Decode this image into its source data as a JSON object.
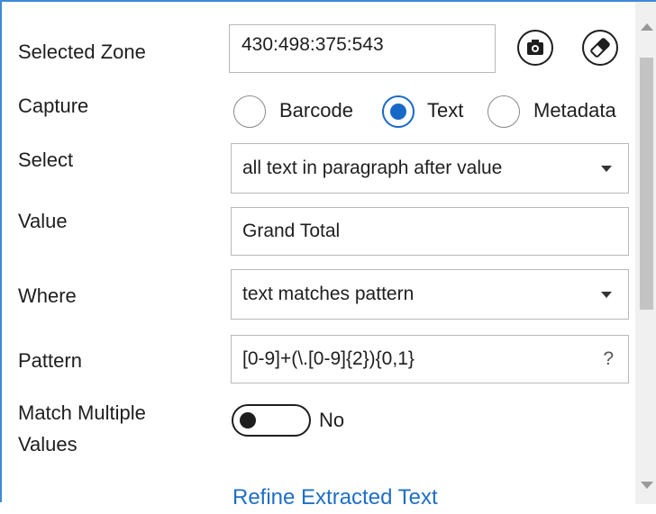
{
  "fields": {
    "selected_zone": {
      "label": "Selected Zone",
      "value": "430:498:375:543"
    },
    "capture": {
      "label": "Capture",
      "options": [
        "Barcode",
        "Text",
        "Metadata"
      ],
      "selected": "Text"
    },
    "select": {
      "label": "Select",
      "value": "all text in paragraph after value"
    },
    "value": {
      "label": "Value",
      "value": "Grand Total"
    },
    "where": {
      "label": "Where",
      "value": "text matches pattern"
    },
    "pattern": {
      "label": "Pattern",
      "value": "[0-9]+(\\.[0-9]{2}){0,1}",
      "help": "?"
    },
    "match_multiple": {
      "label_line1": "Match Multiple",
      "label_line2": "Values",
      "state": "No"
    }
  },
  "link": {
    "label": "Refine Extracted Text"
  },
  "icons": {
    "capture_zone": "camera-icon",
    "clear_zone": "eraser-icon"
  },
  "colors": {
    "accent": "#1769c7",
    "border": "#3c8ad8",
    "link": "#1f6fc5"
  }
}
